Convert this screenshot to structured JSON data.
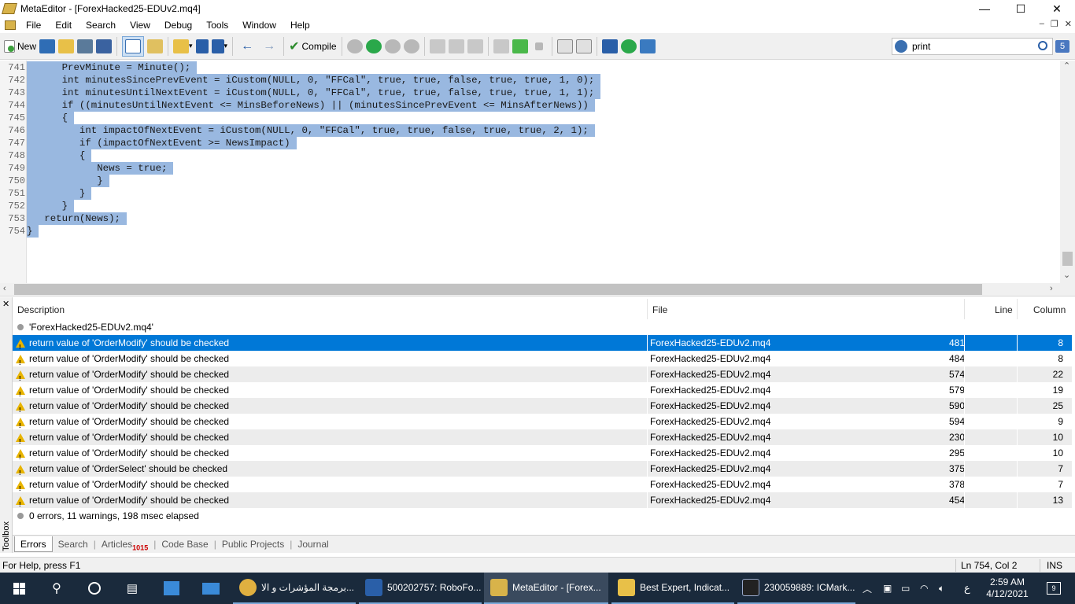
{
  "window": {
    "title": "MetaEditor - [ForexHacked25-EDUv2.mq4]",
    "minimize": "—",
    "maximize": "☐",
    "close": "✕"
  },
  "menu": [
    "File",
    "Edit",
    "Search",
    "View",
    "Debug",
    "Tools",
    "Window",
    "Help"
  ],
  "mdi": {
    "minimize": "–",
    "restore": "❐",
    "close": "✕"
  },
  "toolbar": {
    "new_label": "New",
    "compile_label": "Compile"
  },
  "search": {
    "value": "print",
    "badge": "5"
  },
  "code": [
    {
      "ln": "741",
      "text": "      PrevMinute = Minute();"
    },
    {
      "ln": "742",
      "text": "      int minutesSincePrevEvent = iCustom(NULL, 0, \"FFCal\", true, true, false, true, true, 1, 0);"
    },
    {
      "ln": "743",
      "text": "      int minutesUntilNextEvent = iCustom(NULL, 0, \"FFCal\", true, true, false, true, true, 1, 1);"
    },
    {
      "ln": "744",
      "text": "      if ((minutesUntilNextEvent <= MinsBeforeNews) || (minutesSincePrevEvent <= MinsAfterNews))"
    },
    {
      "ln": "745",
      "text": "      {"
    },
    {
      "ln": "746",
      "text": "         int impactOfNextEvent = iCustom(NULL, 0, \"FFCal\", true, true, false, true, true, 2, 1);"
    },
    {
      "ln": "747",
      "text": "         if (impactOfNextEvent >= NewsImpact)"
    },
    {
      "ln": "748",
      "text": "         {"
    },
    {
      "ln": "749",
      "text": "            News = true;"
    },
    {
      "ln": "750",
      "text": "            }"
    },
    {
      "ln": "751",
      "text": "         }"
    },
    {
      "ln": "752",
      "text": "      }"
    },
    {
      "ln": "753",
      "text": "   return(News);"
    },
    {
      "ln": "754",
      "text": "}"
    }
  ],
  "errors": {
    "headers": {
      "description": "Description",
      "file": "File",
      "line": "Line",
      "column": "Column"
    },
    "file_title": "'ForexHacked25-EDUv2.mq4'",
    "rows": [
      {
        "desc": "return value of 'OrderModify' should be checked",
        "file": "ForexHacked25-EDUv2.mq4",
        "line": "481",
        "col": "8"
      },
      {
        "desc": "return value of 'OrderModify' should be checked",
        "file": "ForexHacked25-EDUv2.mq4",
        "line": "484",
        "col": "8"
      },
      {
        "desc": "return value of 'OrderModify' should be checked",
        "file": "ForexHacked25-EDUv2.mq4",
        "line": "574",
        "col": "22"
      },
      {
        "desc": "return value of 'OrderModify' should be checked",
        "file": "ForexHacked25-EDUv2.mq4",
        "line": "579",
        "col": "19"
      },
      {
        "desc": "return value of 'OrderModify' should be checked",
        "file": "ForexHacked25-EDUv2.mq4",
        "line": "590",
        "col": "25"
      },
      {
        "desc": "return value of 'OrderModify' should be checked",
        "file": "ForexHacked25-EDUv2.mq4",
        "line": "594",
        "col": "9"
      },
      {
        "desc": "return value of 'OrderModify' should be checked",
        "file": "ForexHacked25-EDUv2.mq4",
        "line": "230",
        "col": "10"
      },
      {
        "desc": "return value of 'OrderModify' should be checked",
        "file": "ForexHacked25-EDUv2.mq4",
        "line": "295",
        "col": "10"
      },
      {
        "desc": "return value of 'OrderSelect' should be checked",
        "file": "ForexHacked25-EDUv2.mq4",
        "line": "375",
        "col": "7"
      },
      {
        "desc": "return value of 'OrderModify' should be checked",
        "file": "ForexHacked25-EDUv2.mq4",
        "line": "378",
        "col": "7"
      },
      {
        "desc": "return value of 'OrderModify' should be checked",
        "file": "ForexHacked25-EDUv2.mq4",
        "line": "454",
        "col": "13"
      }
    ],
    "summary": "0 errors, 11 warnings, 198 msec elapsed"
  },
  "toolbox": {
    "label": "Toolbox",
    "close": "✕"
  },
  "tabs": {
    "errors": "Errors",
    "search": "Search",
    "articles": "Articles",
    "articles_count": "1015",
    "codebase": "Code Base",
    "projects": "Public Projects",
    "journal": "Journal"
  },
  "status": {
    "help": "For Help, press F1",
    "position": "Ln 754, Col 2",
    "mode": "INS"
  },
  "taskbar": {
    "items": [
      "برمجة المؤشرات و الا...",
      "500202757: RoboFo...",
      "MetaEditor - [Forex...",
      "Best Expert, Indicat...",
      "230059889: ICMark..."
    ],
    "lang": "ع",
    "time": "2:59 AM",
    "date": "4/12/2021",
    "notifications": "9"
  },
  "colors": {
    "selection": "#99b8e0",
    "row_selected": "#0078d7",
    "warning": "#e8b400",
    "taskbar": "#1a2a3c"
  }
}
